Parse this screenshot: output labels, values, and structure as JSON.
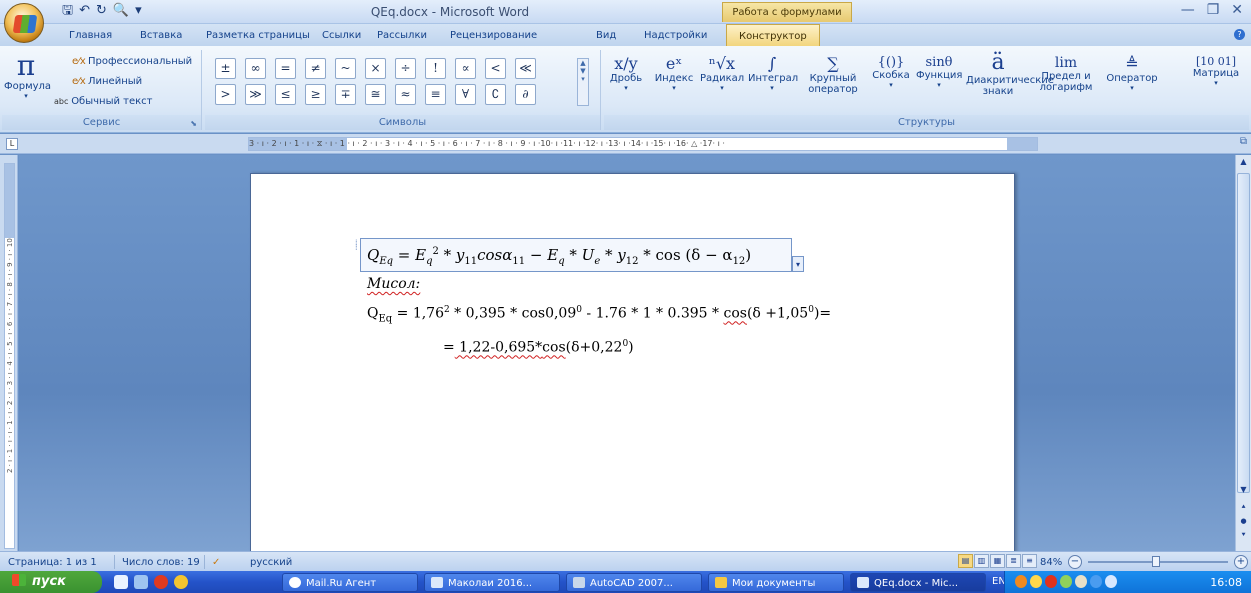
{
  "window": {
    "title": "QEq.docx - Microsoft Word",
    "contextual_title": "Работа с формулами",
    "controls": {
      "minimize": "—",
      "restore": "❐",
      "close": "✕"
    }
  },
  "qat": {
    "save": "🖫",
    "undo": "↶",
    "redo": "↻",
    "print_preview": "🔍",
    "customize": "▾"
  },
  "tabs": [
    "Главная",
    "Вставка",
    "Разметка страницы",
    "Ссылки",
    "Рассылки",
    "Рецензирование",
    "Вид",
    "Надстройки",
    "Конструктор"
  ],
  "active_tab": "Конструктор",
  "ribbon": {
    "service": {
      "formula_icon": "π",
      "formula_label": "Формула",
      "professional": "Профессиональный",
      "linear": "Линейный",
      "normal_text_prefix": "abc",
      "normal_text": "Обычный текст",
      "group_label": "Сервис"
    },
    "symbols": {
      "items": [
        "±",
        "∞",
        "=",
        "≠",
        "~",
        "×",
        "÷",
        "!",
        "∝",
        "<",
        "≪",
        ">",
        "≫",
        "≤",
        "≥",
        "∓",
        "≅",
        "≈",
        "≡",
        "∀",
        "∁",
        "∂"
      ],
      "group_label": "Символы"
    },
    "structures": {
      "items": [
        {
          "icon": "x/y",
          "label": "Дробь"
        },
        {
          "icon": "eˣ",
          "label": "Индекс"
        },
        {
          "icon": "ⁿ√x",
          "label": "Радикал"
        },
        {
          "icon": "∫",
          "label": "Интеграл"
        },
        {
          "icon": "∑",
          "label": "Крупный оператор"
        },
        {
          "icon": "{()}",
          "label": "Скобка"
        },
        {
          "icon": "sinθ",
          "label": "Функция"
        },
        {
          "icon": "ä",
          "label": "Диакритические знаки"
        },
        {
          "icon": "lim",
          "label": "Предел и логарифм"
        },
        {
          "icon": "≜",
          "label": "Оператор"
        },
        {
          "icon": "[10 01]",
          "label": "Матрица"
        }
      ],
      "group_label": "Структуры"
    }
  },
  "ruler": {
    "horizontal": "3 · ı · 2 · ı · 1 · ı · ⧖ · ı · 1 · ı · 2 · ı · 3 · ı · 4 · ı · 5 · ı · 6 · ı · 7 · ı · 8 · ı · 9 · ı ·10· ı ·11· ı ·12· ı ·13· ı ·14· ı ·15· ı ·16· △ ·17· ı ·",
    "vertical": "2 · ı · 1 · ı · ı · 1 · ı · 2 · ı · 3 · ı · 4 · ı · 5 · ı · 6 · ı · 7 · ı · 8 · ı · 9 · ı · 10"
  },
  "document": {
    "eq": {
      "q": "Q",
      "q_sub": "Eq",
      "eq1": " = ",
      "e": "E",
      "e_sub": "q",
      "e_sup": "2",
      "t1": " * ",
      "y": "y",
      "y_sub": "11",
      "cos": "cos",
      "alpha": "α",
      "alpha_sub": "11",
      "minus": " − ",
      "e2": "E",
      "e2_sub": "q",
      "t2": " * ",
      "u": "U",
      "u_sub": "e",
      "t3": " * ",
      "y2": "y",
      "y2_sub": "12",
      "tail": " * cos (δ − α",
      "tail_sub": "12",
      "close": ")"
    },
    "misol": "Мисол:",
    "line3": {
      "q": "Q",
      "q_sub": "Eq",
      "a": " = 1,76",
      "a_sup": "2",
      "b": " * 0,395 * cos0,09",
      "b_sup": "0",
      "c": " - 1.76 * 1 * 0.395 * ",
      "cos": "cos",
      "d": "(δ +1,05",
      "d_sup": "0",
      "e": ")="
    },
    "line4": {
      "eq": "=",
      "val": " 1,22-0,695*",
      "cos": "cos",
      "paren": "(δ+0,22",
      "sup": "0",
      "close": ")"
    }
  },
  "statusbar": {
    "page": "Страница: 1 из 1",
    "words": "Число слов: 19",
    "language": "русский",
    "zoom": "84%"
  },
  "taskbar": {
    "start": "пуск",
    "items": [
      "Mail.Ru Агент",
      "Маколаи 2016...",
      "AutoCAD 2007...",
      "Мои документы",
      "QEq.docx - Mic..."
    ],
    "lang": "EN",
    "clock": "16:08"
  }
}
